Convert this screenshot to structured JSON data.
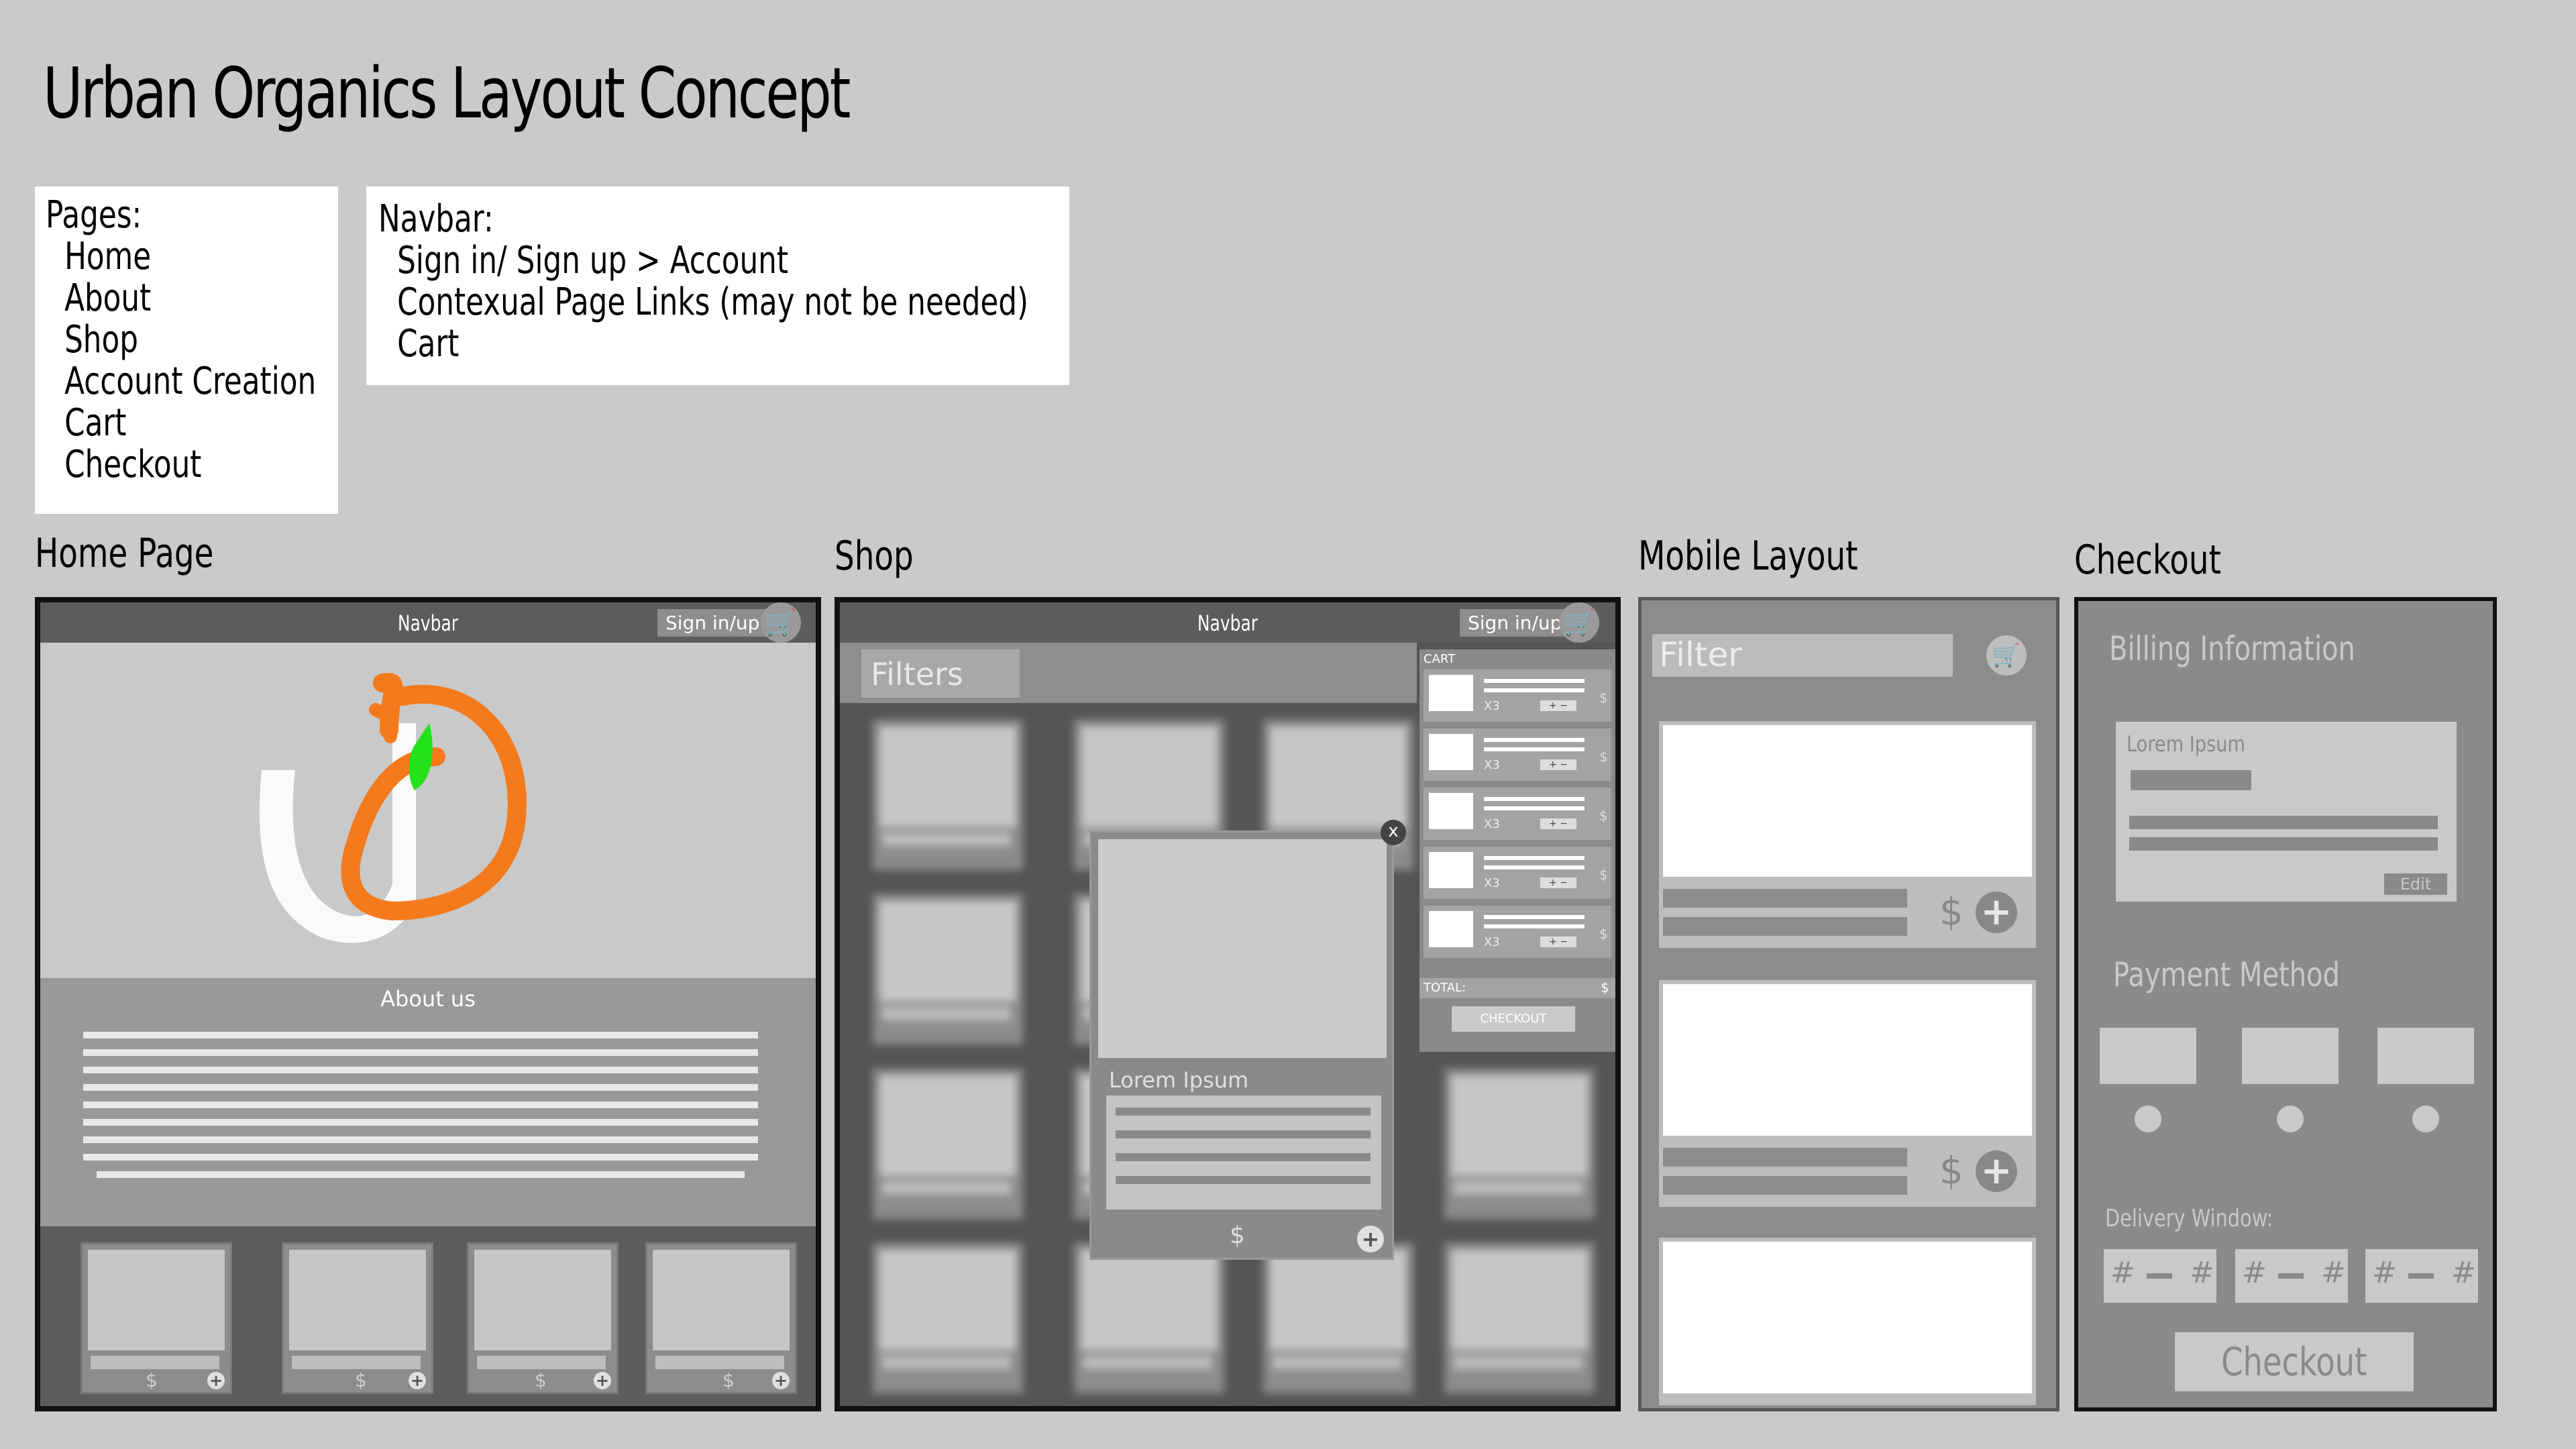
{
  "title": "Urban Organics Layout Concept",
  "pages_note": {
    "heading": "Pages:",
    "items": [
      "Home",
      "About",
      "Shop",
      "Account Creation",
      "Cart",
      "Checkout"
    ]
  },
  "navbar_note": {
    "heading": "Navbar:",
    "items": [
      "Sign in/ Sign up > Account",
      "Contexual Page Links (may not be needed)",
      "Cart"
    ]
  },
  "sections": {
    "home": "Home Page",
    "shop": "Shop",
    "mobile": "Mobile Layout",
    "checkout": "Checkout"
  },
  "home": {
    "navbar": "Navbar",
    "signin": "Sign in/up",
    "about_heading": "About us",
    "price": "$",
    "cart_icon": "cart-icon",
    "plus_icon": "plus-icon"
  },
  "shop": {
    "navbar": "Navbar",
    "signin": "Sign in/up",
    "filters": "Filters",
    "cart_heading": "CART",
    "qty": "X3",
    "item_price": "$",
    "total_label": "TOTAL:",
    "total_value": "$",
    "checkout_btn": "CHECKOUT",
    "modal_title": "Lorem Ipsum",
    "modal_price": "$",
    "close": "x"
  },
  "mobile": {
    "filter": "Filter",
    "price": "$"
  },
  "checkout": {
    "billing_heading": "Billing Information",
    "billing_name": "Lorem Ipsum",
    "edit": "Edit",
    "payment_heading": "Payment Method",
    "delivery_heading": "Delivery Window:",
    "hash": "#",
    "checkout_btn": "Checkout"
  },
  "colors": {
    "background": "#cacaca",
    "logo_orange": "#f47a1c",
    "logo_green": "#22e31a",
    "dark_nav": "#5c5c5c"
  }
}
